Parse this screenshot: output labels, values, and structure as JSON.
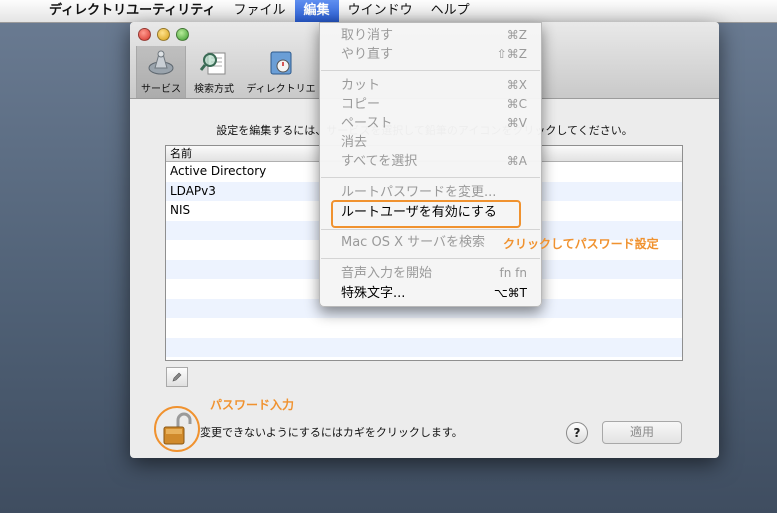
{
  "menubar": {
    "items": [
      "ディレクトリユーティリティ",
      "ファイル",
      "編集",
      "ウインドウ",
      "ヘルプ"
    ]
  },
  "toolbar": {
    "buttons": [
      {
        "label": "サービス"
      },
      {
        "label": "検索方式"
      },
      {
        "label": "ディレクトリエ"
      }
    ]
  },
  "main": {
    "instruction": "設定を編集するには、サービスを選択して鉛筆のアイコンをクリックしてください。",
    "column_header": "名前",
    "services": [
      "Active Directory",
      "LDAPv3",
      "NIS"
    ],
    "edit_icon": "pencil-icon",
    "lock_text": "変更できないようにするにはカギをクリックします。",
    "help_label": "?",
    "apply_label": "適用"
  },
  "edit_menu": {
    "items": [
      {
        "label": "取り消す",
        "shortcut": "⌘Z"
      },
      {
        "label": "やり直す",
        "shortcut": "⇧⌘Z"
      },
      {
        "label": "カット",
        "shortcut": "⌘X"
      },
      {
        "label": "コピー",
        "shortcut": "⌘C"
      },
      {
        "label": "ペースト",
        "shortcut": "⌘V"
      },
      {
        "label": "消去",
        "shortcut": ""
      },
      {
        "label": "すべてを選択",
        "shortcut": "⌘A"
      },
      {
        "label": "ルートパスワードを変更...",
        "shortcut": ""
      },
      {
        "label": "ルートユーザを有効にする",
        "shortcut": ""
      },
      {
        "label": "Mac OS X サーバを検索",
        "shortcut": ""
      },
      {
        "label": "音声入力を開始",
        "shortcut": "fn fn"
      },
      {
        "label": "特殊文字...",
        "shortcut": "⌥⌘T"
      }
    ]
  },
  "annotations": {
    "click_note": "クリックしてパスワード設定",
    "password_note": "パスワード入力"
  },
  "colors": {
    "annotation_orange": "#f0922f",
    "menu_highlight_blue": "#2a5fd8"
  }
}
